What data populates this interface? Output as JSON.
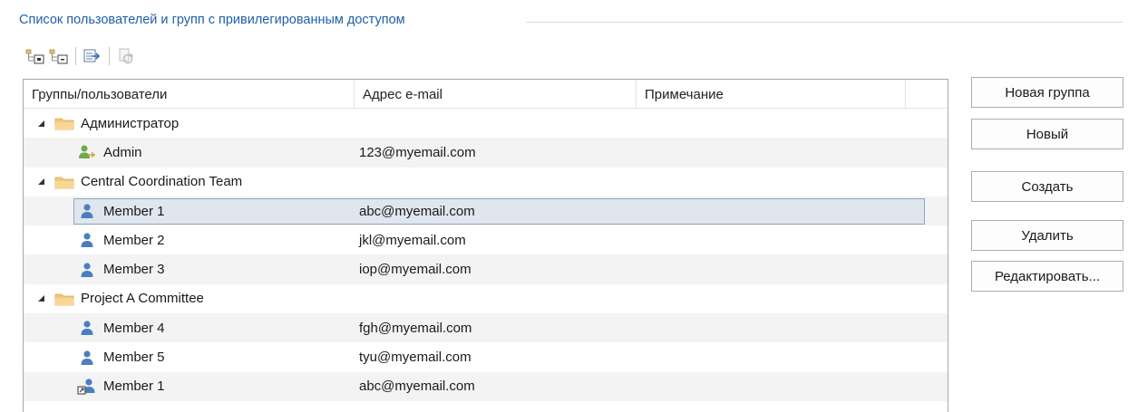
{
  "group_box": {
    "title": "Список пользователей и групп с привилегированным доступом"
  },
  "toolbar": {
    "buttons": [
      {
        "icon": "add-group-icon"
      },
      {
        "icon": "remove-group-icon"
      },
      {
        "icon": "export-icon"
      },
      {
        "icon": "refresh-icon"
      }
    ]
  },
  "table": {
    "columns": [
      "Группы/пользователи",
      "Адрес e-mail",
      "Примечание",
      ""
    ],
    "rows": [
      {
        "type": "group",
        "name": "Администратор",
        "email": ""
      },
      {
        "type": "admin",
        "name": "Admin",
        "email": "123@myemail.com"
      },
      {
        "type": "group",
        "name": "Central Coordination Team",
        "email": ""
      },
      {
        "type": "user",
        "name": "Member 1",
        "email": "abc@myemail.com",
        "selected": true
      },
      {
        "type": "user",
        "name": "Member 2",
        "email": "jkl@myemail.com"
      },
      {
        "type": "user",
        "name": "Member 3",
        "email": "iop@myemail.com"
      },
      {
        "type": "group",
        "name": "Project A Committee",
        "email": ""
      },
      {
        "type": "user",
        "name": "Member 4",
        "email": "fgh@myemail.com"
      },
      {
        "type": "user",
        "name": "Member 5",
        "email": "tyu@myemail.com"
      },
      {
        "type": "linked-user",
        "name": "Member 1",
        "email": "abc@myemail.com"
      }
    ]
  },
  "buttons": {
    "new_group": "Новая группа",
    "new": "Новый",
    "create": "Создать",
    "delete": "Удалить",
    "edit": "Редактировать..."
  },
  "colors": {
    "title_blue": "#1f5fa8",
    "folder": "#f0c77a",
    "user_blue": "#4a7fbf",
    "selection_bg": "#dfe6ee",
    "selection_border": "#8fa6bd"
  }
}
